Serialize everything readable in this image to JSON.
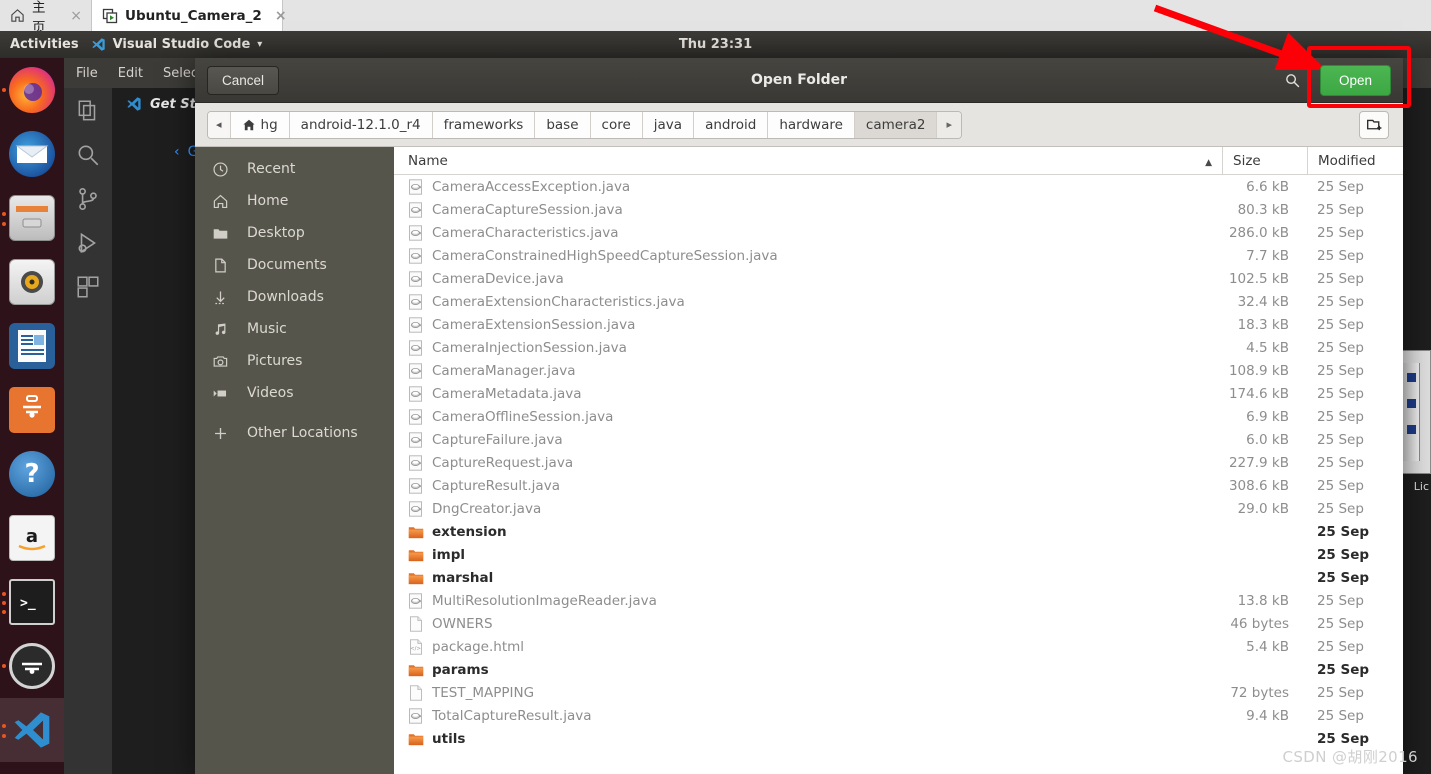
{
  "browser": {
    "tabs": [
      {
        "label": "主页",
        "icon": "home-icon",
        "active": false,
        "close": "×"
      },
      {
        "label": "Ubuntu_Camera_2",
        "icon": "vm-icon",
        "active": true,
        "close": "×"
      }
    ]
  },
  "top_panel": {
    "activities": "Activities",
    "app_name": "Visual Studio Code",
    "app_menu_caret": "▾",
    "clock": "Thu 23:31"
  },
  "dock": {
    "items": [
      {
        "name": "firefox",
        "label": "Firefox",
        "running": true,
        "selected": false
      },
      {
        "name": "thunderbird",
        "label": "Thunderbird",
        "running": false,
        "selected": false
      },
      {
        "name": "files",
        "label": "Files",
        "running": true,
        "selected": false
      },
      {
        "name": "rhythmbox",
        "label": "Rhythmbox",
        "running": false,
        "selected": false
      },
      {
        "name": "libreoffice-writer",
        "label": "LibreOffice Writer",
        "running": false,
        "selected": false
      },
      {
        "name": "ubuntu-software",
        "label": "Ubuntu Software",
        "running": false,
        "selected": false
      },
      {
        "name": "help",
        "label": "Help",
        "running": false,
        "selected": false
      },
      {
        "name": "amazon",
        "label": "Amazon",
        "running": false,
        "selected": false
      },
      {
        "name": "terminal",
        "label": "Terminal",
        "running": true,
        "selected": false
      },
      {
        "name": "software-updater",
        "label": "Software Updater",
        "running": true,
        "selected": false
      },
      {
        "name": "vscode",
        "label": "Visual Studio Code",
        "running": true,
        "selected": true
      }
    ]
  },
  "vscode": {
    "menu": [
      "File",
      "Edit",
      "Selection"
    ],
    "tab_label": "Get Started",
    "link_label": "Ge",
    "activity_icons": [
      "explorer-icon",
      "search-icon",
      "source-control-icon",
      "run-debug-icon",
      "extensions-icon"
    ],
    "right_label": "Lic"
  },
  "dialog": {
    "title": "Open Folder",
    "cancel_label": "Cancel",
    "open_label": "Open",
    "search_icon": "search-icon",
    "new_folder_icon": "new-folder-icon",
    "breadcrumbs": [
      {
        "label": "◂",
        "type": "nav-prev"
      },
      {
        "label": "hg",
        "type": "home",
        "icon": "home-icon"
      },
      {
        "label": "android-12.1.0_r4",
        "type": "crumb"
      },
      {
        "label": "frameworks",
        "type": "crumb"
      },
      {
        "label": "base",
        "type": "crumb"
      },
      {
        "label": "core",
        "type": "crumb"
      },
      {
        "label": "java",
        "type": "crumb"
      },
      {
        "label": "android",
        "type": "crumb"
      },
      {
        "label": "hardware",
        "type": "crumb"
      },
      {
        "label": "camera2",
        "type": "current"
      },
      {
        "label": "▸",
        "type": "nav-next"
      }
    ],
    "places": [
      {
        "label": "Recent",
        "icon": "clock-icon"
      },
      {
        "label": "Home",
        "icon": "home-icon"
      },
      {
        "label": "Desktop",
        "icon": "folder-icon"
      },
      {
        "label": "Documents",
        "icon": "document-icon"
      },
      {
        "label": "Downloads",
        "icon": "download-icon"
      },
      {
        "label": "Music",
        "icon": "music-icon"
      },
      {
        "label": "Pictures",
        "icon": "camera-icon"
      },
      {
        "label": "Videos",
        "icon": "video-icon"
      },
      {
        "label": "Other Locations",
        "icon": "plus-icon"
      }
    ],
    "columns": {
      "name": "Name",
      "size": "Size",
      "modified": "Modified",
      "sort_arrow": "▲"
    },
    "files": [
      {
        "name": "CameraAccessException.java",
        "size": "6.6 kB",
        "modified": "25 Sep",
        "kind": "java"
      },
      {
        "name": "CameraCaptureSession.java",
        "size": "80.3 kB",
        "modified": "25 Sep",
        "kind": "java"
      },
      {
        "name": "CameraCharacteristics.java",
        "size": "286.0 kB",
        "modified": "25 Sep",
        "kind": "java"
      },
      {
        "name": "CameraConstrainedHighSpeedCaptureSession.java",
        "size": "7.7 kB",
        "modified": "25 Sep",
        "kind": "java"
      },
      {
        "name": "CameraDevice.java",
        "size": "102.5 kB",
        "modified": "25 Sep",
        "kind": "java"
      },
      {
        "name": "CameraExtensionCharacteristics.java",
        "size": "32.4 kB",
        "modified": "25 Sep",
        "kind": "java"
      },
      {
        "name": "CameraExtensionSession.java",
        "size": "18.3 kB",
        "modified": "25 Sep",
        "kind": "java"
      },
      {
        "name": "CameraInjectionSession.java",
        "size": "4.5 kB",
        "modified": "25 Sep",
        "kind": "java"
      },
      {
        "name": "CameraManager.java",
        "size": "108.9 kB",
        "modified": "25 Sep",
        "kind": "java"
      },
      {
        "name": "CameraMetadata.java",
        "size": "174.6 kB",
        "modified": "25 Sep",
        "kind": "java"
      },
      {
        "name": "CameraOfflineSession.java",
        "size": "6.9 kB",
        "modified": "25 Sep",
        "kind": "java"
      },
      {
        "name": "CaptureFailure.java",
        "size": "6.0 kB",
        "modified": "25 Sep",
        "kind": "java"
      },
      {
        "name": "CaptureRequest.java",
        "size": "227.9 kB",
        "modified": "25 Sep",
        "kind": "java"
      },
      {
        "name": "CaptureResult.java",
        "size": "308.6 kB",
        "modified": "25 Sep",
        "kind": "java"
      },
      {
        "name": "DngCreator.java",
        "size": "29.0 kB",
        "modified": "25 Sep",
        "kind": "java"
      },
      {
        "name": "extension",
        "size": "",
        "modified": "25 Sep",
        "kind": "folder"
      },
      {
        "name": "impl",
        "size": "",
        "modified": "25 Sep",
        "kind": "folder"
      },
      {
        "name": "marshal",
        "size": "",
        "modified": "25 Sep",
        "kind": "folder"
      },
      {
        "name": "MultiResolutionImageReader.java",
        "size": "13.8 kB",
        "modified": "25 Sep",
        "kind": "java"
      },
      {
        "name": "OWNERS",
        "size": "46 bytes",
        "modified": "25 Sep",
        "kind": "file"
      },
      {
        "name": "package.html",
        "size": "5.4 kB",
        "modified": "25 Sep",
        "kind": "html"
      },
      {
        "name": "params",
        "size": "",
        "modified": "25 Sep",
        "kind": "folder"
      },
      {
        "name": "TEST_MAPPING",
        "size": "72 bytes",
        "modified": "25 Sep",
        "kind": "file"
      },
      {
        "name": "TotalCaptureResult.java",
        "size": "9.4 kB",
        "modified": "25 Sep",
        "kind": "java"
      },
      {
        "name": "utils",
        "size": "",
        "modified": "25 Sep",
        "kind": "folder"
      }
    ]
  },
  "annotation": {
    "color": "#fb0007",
    "target": "open-button"
  },
  "watermark": "CSDN @胡刚2016"
}
